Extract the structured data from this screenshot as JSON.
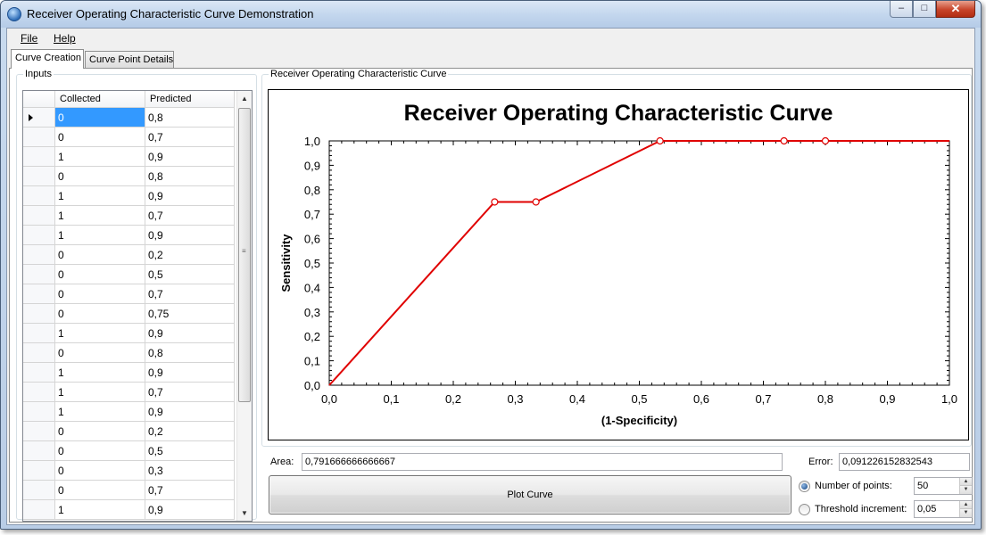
{
  "window": {
    "title": "Receiver Operating Characteristic Curve Demonstration",
    "buttons": {
      "minimize": "–",
      "maximize": "□",
      "close": "✕"
    }
  },
  "menu": {
    "file": "File",
    "help": "Help"
  },
  "tabs": [
    {
      "label": "Curve Creation",
      "active": true
    },
    {
      "label": "Curve Point Details",
      "active": false
    }
  ],
  "inputs": {
    "group_label": "Inputs",
    "columns": [
      "Collected",
      "Predicted"
    ],
    "rows": [
      {
        "collected": "0",
        "predicted": "0,8"
      },
      {
        "collected": "0",
        "predicted": "0,7"
      },
      {
        "collected": "1",
        "predicted": "0,9"
      },
      {
        "collected": "0",
        "predicted": "0,8"
      },
      {
        "collected": "1",
        "predicted": "0,9"
      },
      {
        "collected": "1",
        "predicted": "0,7"
      },
      {
        "collected": "1",
        "predicted": "0,9"
      },
      {
        "collected": "0",
        "predicted": "0,2"
      },
      {
        "collected": "0",
        "predicted": "0,5"
      },
      {
        "collected": "0",
        "predicted": "0,7"
      },
      {
        "collected": "0",
        "predicted": "0,75"
      },
      {
        "collected": "1",
        "predicted": "0,9"
      },
      {
        "collected": "0",
        "predicted": "0,8"
      },
      {
        "collected": "1",
        "predicted": "0,9"
      },
      {
        "collected": "1",
        "predicted": "0,7"
      },
      {
        "collected": "1",
        "predicted": "0,9"
      },
      {
        "collected": "0",
        "predicted": "0,2"
      },
      {
        "collected": "0",
        "predicted": "0,5"
      },
      {
        "collected": "0",
        "predicted": "0,3"
      },
      {
        "collected": "0",
        "predicted": "0,7"
      },
      {
        "collected": "1",
        "predicted": "0,9"
      }
    ]
  },
  "curve": {
    "group_label": "Receiver Operating Characteristic Curve"
  },
  "chart_data": {
    "type": "line",
    "title": "Receiver Operating Characteristic Curve",
    "xlabel": "(1-Specificity)",
    "ylabel": "Sensitivity",
    "xlim": [
      0,
      1
    ],
    "ylim": [
      0,
      1
    ],
    "xticks": [
      "0,0",
      "0,1",
      "0,2",
      "0,3",
      "0,4",
      "0,5",
      "0,6",
      "0,7",
      "0,8",
      "0,9",
      "1,0"
    ],
    "yticks": [
      "0,0",
      "0,1",
      "0,2",
      "0,3",
      "0,4",
      "0,5",
      "0,6",
      "0,7",
      "0,8",
      "0,9",
      "1,0"
    ],
    "grid": false,
    "series": [
      {
        "color": "#e00000",
        "x": [
          0.0,
          0.2667,
          0.3333,
          0.5333,
          0.7333,
          0.8,
          1.0
        ],
        "y": [
          0.0,
          0.75,
          0.75,
          1.0,
          1.0,
          1.0,
          1.0
        ],
        "markers": [
          false,
          true,
          true,
          true,
          true,
          true,
          false
        ]
      }
    ]
  },
  "stats": {
    "area_label": "Area:",
    "area_value": "0,791666666666667",
    "error_label": "Error:",
    "error_value": "0,091226152832543"
  },
  "controls": {
    "plot_button": "Plot Curve",
    "number_of_points_label": "Number of points:",
    "number_of_points_value": "50",
    "number_of_points_checked": true,
    "threshold_increment_label": "Threshold increment:",
    "threshold_increment_value": "0,05",
    "threshold_increment_checked": false
  }
}
